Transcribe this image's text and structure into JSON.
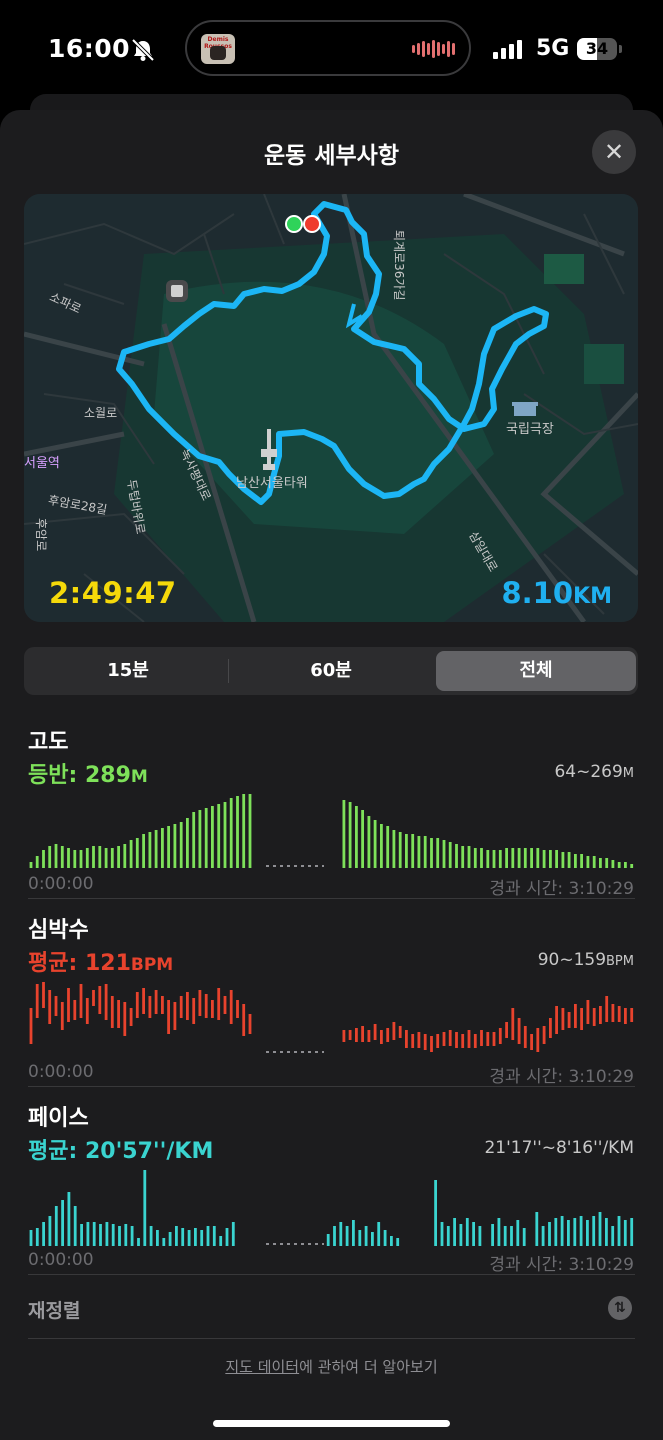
{
  "status_bar": {
    "time": "16:00",
    "network": "5G",
    "battery": "34",
    "album_text": "Demis Roussos"
  },
  "sheet": {
    "title": "운동 세부사항"
  },
  "map": {
    "duration": "2:49:47",
    "distance_value": "8.10",
    "distance_unit": "KM",
    "labels": {
      "tower": "남산서울타워",
      "theater": "국립극장",
      "station": "서울역",
      "road1": "소파로",
      "road2": "소월로",
      "road3": "퇴계로36가길",
      "road4": "녹사평대로",
      "road5": "후암로28길",
      "road6": "두텁바위로",
      "road7": "삼일대로",
      "road8": "후암로"
    }
  },
  "segments": {
    "items": [
      "15분",
      "60분",
      "전체"
    ],
    "selected": "전체"
  },
  "elevation": {
    "title": "고도",
    "stat_label": "등반:",
    "stat_value": "289",
    "stat_unit": "M",
    "range": "64~269",
    "range_unit": "M",
    "start": "0:00:00",
    "end": "경과 시간: 3:10:29",
    "color": "#7ee15a"
  },
  "heart_rate": {
    "title": "심박수",
    "stat_label": "평균:",
    "stat_value": "121",
    "stat_unit": "BPM",
    "range": "90~159",
    "range_unit": "BPM",
    "start": "0:00:00",
    "end": "경과 시간: 3:10:29",
    "color": "#e8432d"
  },
  "pace": {
    "title": "페이스",
    "stat_label": "평균:",
    "stat_value": "20'57''/KM",
    "range": "21'17''~8'16''/KM",
    "start": "0:00:00",
    "end": "경과 시간: 3:10:29",
    "color": "#3ad4d0"
  },
  "sort": {
    "label": "재정렬"
  },
  "footer": {
    "link": "지도 데이터",
    "text": "에 관하여 더 알아보기"
  }
}
